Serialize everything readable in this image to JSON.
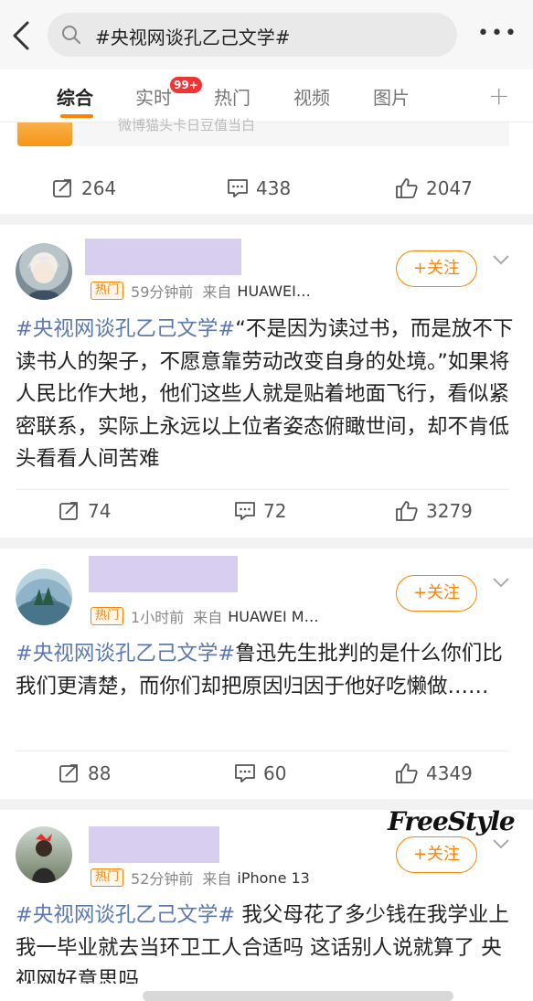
{
  "header": {
    "search_query": "#央视网谈孔乙己文学#",
    "more_label": "•••"
  },
  "tabs": [
    {
      "label": "综合",
      "active": true
    },
    {
      "label": "实时",
      "badge": "99+"
    },
    {
      "label": "热门"
    },
    {
      "label": "视频"
    },
    {
      "label": "图片"
    }
  ],
  "tabs_add": "+",
  "prev_card": {
    "partial_text": "微博猫头卡日豆值当白",
    "repost_count": "264",
    "comment_count": "438",
    "like_count": "2047"
  },
  "posts": [
    {
      "hot_label": "热门",
      "time": "59分钟前",
      "from_label": "来自",
      "device": "HUAWEI…",
      "follow_label": "关注",
      "topic": "#央视网谈孔乙己文学#",
      "text": "“不是因为读过书，而是放不下读书人的架子，不愿意靠劳动改变自身的处境。”如果将人民比作大地，他们这些人就是贴着地面飞行，看似紧密联系，实际上永远以上位者姿态俯瞰世间，却不肯低头看看人间苦难",
      "repost_count": "74",
      "comment_count": "72",
      "like_count": "3279"
    },
    {
      "hot_label": "热门",
      "time": "1小时前",
      "from_label": "来自",
      "device": "HUAWEI M…",
      "follow_label": "关注",
      "topic": "#央视网谈孔乙己文学#",
      "text": "鲁迅先生批判的是什么你们比我们更清楚，而你们却把原因归因于他好吃懒做……",
      "repost_count": "88",
      "comment_count": "60",
      "like_count": "4349"
    },
    {
      "hot_label": "热门",
      "time": "52分钟前",
      "from_label": "来自",
      "device": "iPhone 13",
      "follow_label": "关注",
      "topic": "#央视网谈孔乙己文学#",
      "text": " 我父母花了多少钱在我学业上 我一毕业就去当环卫工人合适吗 这话别人说就算了 央视网好意思吗"
    }
  ],
  "watermark": "FreeStyle",
  "colors": {
    "accent": "#ff8200",
    "topic": "#5b78b0",
    "badge": "#f23333",
    "name_placeholder": "#d8cff0"
  }
}
